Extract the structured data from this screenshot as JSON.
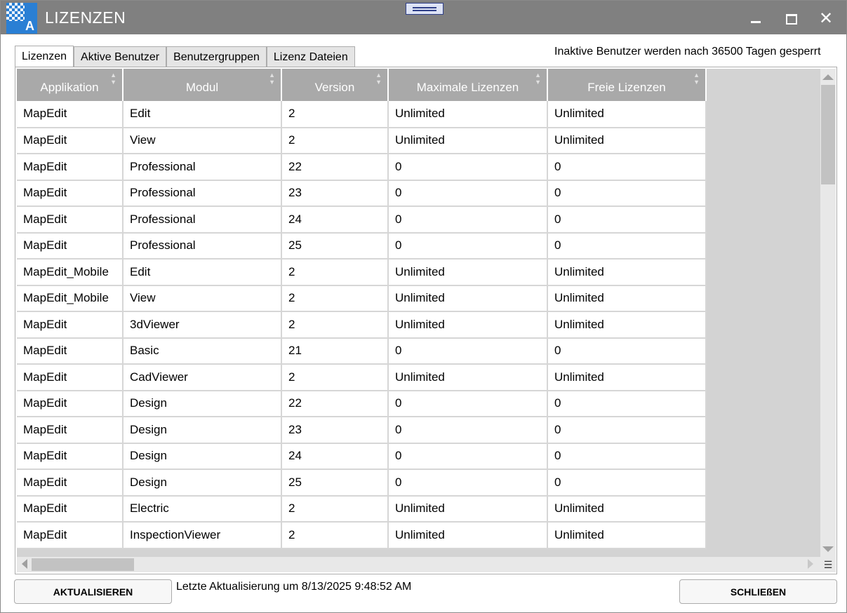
{
  "window": {
    "title": "LIZENZEN",
    "icon_letter": "A",
    "close_glyph": "✕"
  },
  "tabs": [
    {
      "label": "Lizenzen",
      "active": true
    },
    {
      "label": "Aktive Benutzer",
      "active": false
    },
    {
      "label": "Benutzergruppen",
      "active": false
    },
    {
      "label": "Lizenz Dateien",
      "active": false
    }
  ],
  "inactive_note": "Inaktive Benutzer werden nach 36500 Tagen gesperrt",
  "table": {
    "columns": [
      "Applikation",
      "Modul",
      "Version",
      "Maximale Lizenzen",
      "Freie Lizenzen"
    ],
    "rows": [
      [
        "MapEdit",
        "Edit",
        "2",
        "Unlimited",
        "Unlimited"
      ],
      [
        "MapEdit",
        "View",
        "2",
        "Unlimited",
        "Unlimited"
      ],
      [
        "MapEdit",
        "Professional",
        "22",
        "0",
        "0"
      ],
      [
        "MapEdit",
        "Professional",
        "23",
        "0",
        "0"
      ],
      [
        "MapEdit",
        "Professional",
        "24",
        "0",
        "0"
      ],
      [
        "MapEdit",
        "Professional",
        "25",
        "0",
        "0"
      ],
      [
        "MapEdit_Mobile",
        "Edit",
        "2",
        "Unlimited",
        "Unlimited"
      ],
      [
        "MapEdit_Mobile",
        "View",
        "2",
        "Unlimited",
        "Unlimited"
      ],
      [
        "MapEdit",
        "3dViewer",
        "2",
        "Unlimited",
        "Unlimited"
      ],
      [
        "MapEdit",
        "Basic",
        "21",
        "0",
        "0"
      ],
      [
        "MapEdit",
        "CadViewer",
        "2",
        "Unlimited",
        "Unlimited"
      ],
      [
        "MapEdit",
        "Design",
        "22",
        "0",
        "0"
      ],
      [
        "MapEdit",
        "Design",
        "23",
        "0",
        "0"
      ],
      [
        "MapEdit",
        "Design",
        "24",
        "0",
        "0"
      ],
      [
        "MapEdit",
        "Design",
        "25",
        "0",
        "0"
      ],
      [
        "MapEdit",
        "Electric",
        "2",
        "Unlimited",
        "Unlimited"
      ],
      [
        "MapEdit",
        "InspectionViewer",
        "2",
        "Unlimited",
        "Unlimited"
      ]
    ]
  },
  "footer": {
    "refresh_label": "AKTUALISIEREN",
    "last_update": "Letzte Aktualisierung um 8/13/2025 9:48:52 AM",
    "close_label": "SCHLIEßEN"
  },
  "icons": {
    "app": "app-logo-icon",
    "drag": "drag-handle-icon",
    "minimize": "minimize-icon",
    "maximize": "maximize-icon",
    "close": "close-icon",
    "sort": "sort-icon",
    "column_chooser": "column-chooser-icon"
  },
  "colors": {
    "titlebar": "#808080",
    "header": "#a9a9a9",
    "app_icon": "#2a7fd4"
  }
}
